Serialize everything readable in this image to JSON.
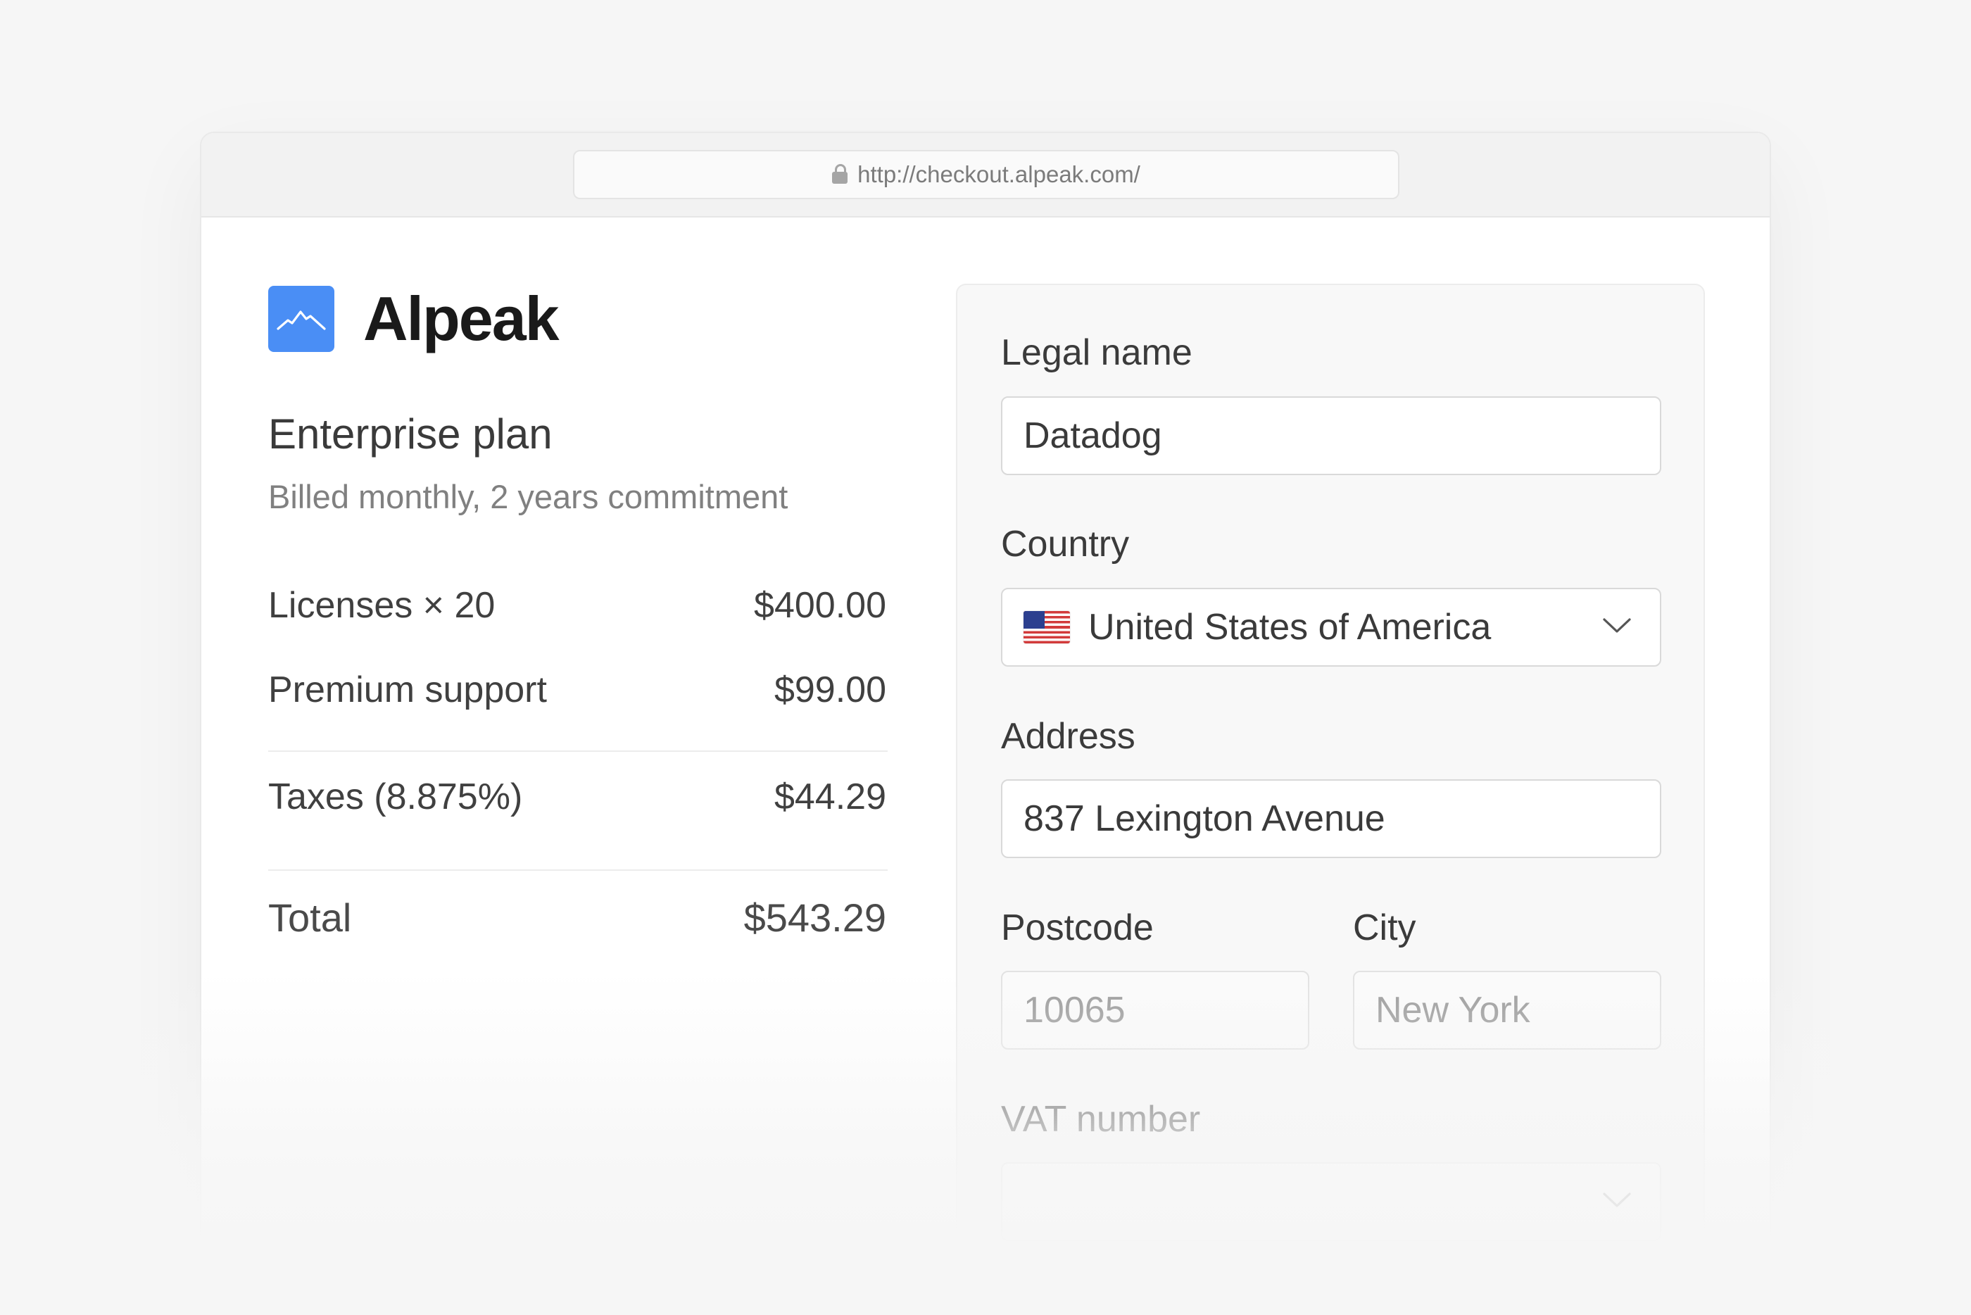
{
  "browser": {
    "url": "http://checkout.alpeak.com/",
    "lock_icon": "lock-icon"
  },
  "brand": {
    "name": "Alpeak",
    "logo_icon": "mountain-logo-icon",
    "logo_color": "#4a8ef5"
  },
  "plan": {
    "title": "Enterprise plan",
    "subtitle": "Billed monthly, 2 years commitment"
  },
  "line_items": [
    {
      "label": "Licenses × 20",
      "amount": "$400.00"
    },
    {
      "label": "Premium support",
      "amount": "$99.00"
    }
  ],
  "taxes": {
    "label": "Taxes (8.875%)",
    "amount": "$44.29"
  },
  "total": {
    "label": "Total",
    "amount": "$543.29"
  },
  "form": {
    "legal_name": {
      "label": "Legal name",
      "value": "Datadog"
    },
    "country": {
      "label": "Country",
      "value": "United States of America",
      "flag_icon": "us-flag-icon"
    },
    "address": {
      "label": "Address",
      "value": "837 Lexington Avenue"
    },
    "postcode": {
      "label": "Postcode",
      "placeholder": "10065"
    },
    "city": {
      "label": "City",
      "placeholder": "New York"
    },
    "vat": {
      "label": "VAT number"
    }
  }
}
